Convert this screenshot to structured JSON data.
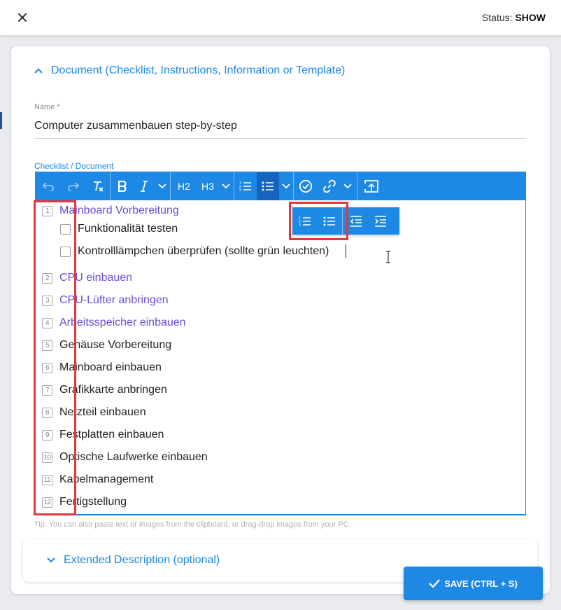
{
  "header": {
    "status_label": "Status:",
    "status_value": "SHOW"
  },
  "section": {
    "title": "Document (Checklist, Instructions, Information or Template)"
  },
  "name_field": {
    "label": "Name *",
    "value": "Computer zusammenbauen step-by-step"
  },
  "editor": {
    "label": "Checklist / Document",
    "toolbar": {
      "h2": "H2",
      "h3": "H3"
    },
    "items": [
      {
        "num": "1",
        "text": "Mainboard Vorbereitung",
        "highlight": true
      },
      {
        "check": true,
        "text": "Funktionalität testen"
      },
      {
        "check": true,
        "text": "Kontrolllämpchen überprüfen (sollte grün leuchten)"
      },
      {
        "num": "2",
        "text": "CPU einbauen",
        "highlight": true
      },
      {
        "num": "3",
        "text": "CPU-Lüfter anbringen",
        "highlight": true
      },
      {
        "num": "4",
        "text": "Arbeitsspeicher einbauen",
        "highlight": true
      },
      {
        "num": "5",
        "text": "Gehäuse Vorbereitung"
      },
      {
        "num": "6",
        "text": "Mainboard einbauen"
      },
      {
        "num": "7",
        "text": "Grafikkarte anbringen"
      },
      {
        "num": "8",
        "text": "Netzteil einbauen"
      },
      {
        "num": "9",
        "text": "Festplatten einbauen"
      },
      {
        "num": "10",
        "text": "Optische Laufwerke einbauen"
      },
      {
        "num": "11",
        "text": "Kabelmanagement"
      },
      {
        "num": "12",
        "text": "Fertigstellung"
      }
    ],
    "tip": "Tip: You can also paste text or images from the clipboard, or drag-drop images from your PC."
  },
  "extended": {
    "title": "Extended Description (optional)"
  },
  "save_button": {
    "label": "SAVE (CTRL + S)"
  },
  "colors": {
    "accent": "#1e88e5",
    "highlight_text": "#6c4cdf",
    "annotation": "#e0393e"
  }
}
